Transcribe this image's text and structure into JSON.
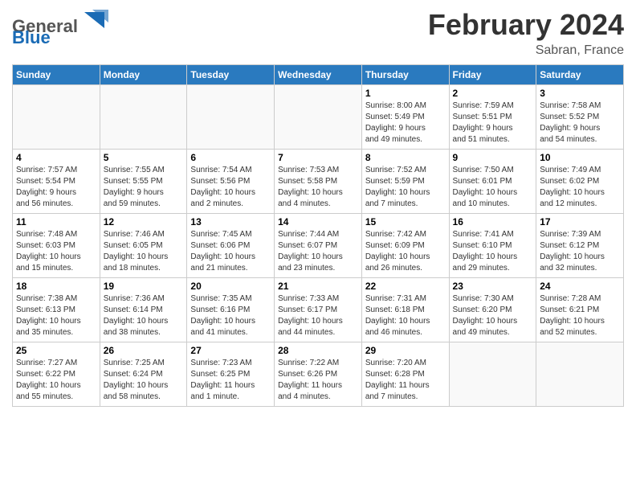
{
  "header": {
    "logo_general": "General",
    "logo_blue": "Blue",
    "month_title": "February 2024",
    "location": "Sabran, France"
  },
  "days_of_week": [
    "Sunday",
    "Monday",
    "Tuesday",
    "Wednesday",
    "Thursday",
    "Friday",
    "Saturday"
  ],
  "weeks": [
    [
      {
        "day": "",
        "info": ""
      },
      {
        "day": "",
        "info": ""
      },
      {
        "day": "",
        "info": ""
      },
      {
        "day": "",
        "info": ""
      },
      {
        "day": "1",
        "info": "Sunrise: 8:00 AM\nSunset: 5:49 PM\nDaylight: 9 hours\nand 49 minutes."
      },
      {
        "day": "2",
        "info": "Sunrise: 7:59 AM\nSunset: 5:51 PM\nDaylight: 9 hours\nand 51 minutes."
      },
      {
        "day": "3",
        "info": "Sunrise: 7:58 AM\nSunset: 5:52 PM\nDaylight: 9 hours\nand 54 minutes."
      }
    ],
    [
      {
        "day": "4",
        "info": "Sunrise: 7:57 AM\nSunset: 5:54 PM\nDaylight: 9 hours\nand 56 minutes."
      },
      {
        "day": "5",
        "info": "Sunrise: 7:55 AM\nSunset: 5:55 PM\nDaylight: 9 hours\nand 59 minutes."
      },
      {
        "day": "6",
        "info": "Sunrise: 7:54 AM\nSunset: 5:56 PM\nDaylight: 10 hours\nand 2 minutes."
      },
      {
        "day": "7",
        "info": "Sunrise: 7:53 AM\nSunset: 5:58 PM\nDaylight: 10 hours\nand 4 minutes."
      },
      {
        "day": "8",
        "info": "Sunrise: 7:52 AM\nSunset: 5:59 PM\nDaylight: 10 hours\nand 7 minutes."
      },
      {
        "day": "9",
        "info": "Sunrise: 7:50 AM\nSunset: 6:01 PM\nDaylight: 10 hours\nand 10 minutes."
      },
      {
        "day": "10",
        "info": "Sunrise: 7:49 AM\nSunset: 6:02 PM\nDaylight: 10 hours\nand 12 minutes."
      }
    ],
    [
      {
        "day": "11",
        "info": "Sunrise: 7:48 AM\nSunset: 6:03 PM\nDaylight: 10 hours\nand 15 minutes."
      },
      {
        "day": "12",
        "info": "Sunrise: 7:46 AM\nSunset: 6:05 PM\nDaylight: 10 hours\nand 18 minutes."
      },
      {
        "day": "13",
        "info": "Sunrise: 7:45 AM\nSunset: 6:06 PM\nDaylight: 10 hours\nand 21 minutes."
      },
      {
        "day": "14",
        "info": "Sunrise: 7:44 AM\nSunset: 6:07 PM\nDaylight: 10 hours\nand 23 minutes."
      },
      {
        "day": "15",
        "info": "Sunrise: 7:42 AM\nSunset: 6:09 PM\nDaylight: 10 hours\nand 26 minutes."
      },
      {
        "day": "16",
        "info": "Sunrise: 7:41 AM\nSunset: 6:10 PM\nDaylight: 10 hours\nand 29 minutes."
      },
      {
        "day": "17",
        "info": "Sunrise: 7:39 AM\nSunset: 6:12 PM\nDaylight: 10 hours\nand 32 minutes."
      }
    ],
    [
      {
        "day": "18",
        "info": "Sunrise: 7:38 AM\nSunset: 6:13 PM\nDaylight: 10 hours\nand 35 minutes."
      },
      {
        "day": "19",
        "info": "Sunrise: 7:36 AM\nSunset: 6:14 PM\nDaylight: 10 hours\nand 38 minutes."
      },
      {
        "day": "20",
        "info": "Sunrise: 7:35 AM\nSunset: 6:16 PM\nDaylight: 10 hours\nand 41 minutes."
      },
      {
        "day": "21",
        "info": "Sunrise: 7:33 AM\nSunset: 6:17 PM\nDaylight: 10 hours\nand 44 minutes."
      },
      {
        "day": "22",
        "info": "Sunrise: 7:31 AM\nSunset: 6:18 PM\nDaylight: 10 hours\nand 46 minutes."
      },
      {
        "day": "23",
        "info": "Sunrise: 7:30 AM\nSunset: 6:20 PM\nDaylight: 10 hours\nand 49 minutes."
      },
      {
        "day": "24",
        "info": "Sunrise: 7:28 AM\nSunset: 6:21 PM\nDaylight: 10 hours\nand 52 minutes."
      }
    ],
    [
      {
        "day": "25",
        "info": "Sunrise: 7:27 AM\nSunset: 6:22 PM\nDaylight: 10 hours\nand 55 minutes."
      },
      {
        "day": "26",
        "info": "Sunrise: 7:25 AM\nSunset: 6:24 PM\nDaylight: 10 hours\nand 58 minutes."
      },
      {
        "day": "27",
        "info": "Sunrise: 7:23 AM\nSunset: 6:25 PM\nDaylight: 11 hours\nand 1 minute."
      },
      {
        "day": "28",
        "info": "Sunrise: 7:22 AM\nSunset: 6:26 PM\nDaylight: 11 hours\nand 4 minutes."
      },
      {
        "day": "29",
        "info": "Sunrise: 7:20 AM\nSunset: 6:28 PM\nDaylight: 11 hours\nand 7 minutes."
      },
      {
        "day": "",
        "info": ""
      },
      {
        "day": "",
        "info": ""
      }
    ]
  ]
}
